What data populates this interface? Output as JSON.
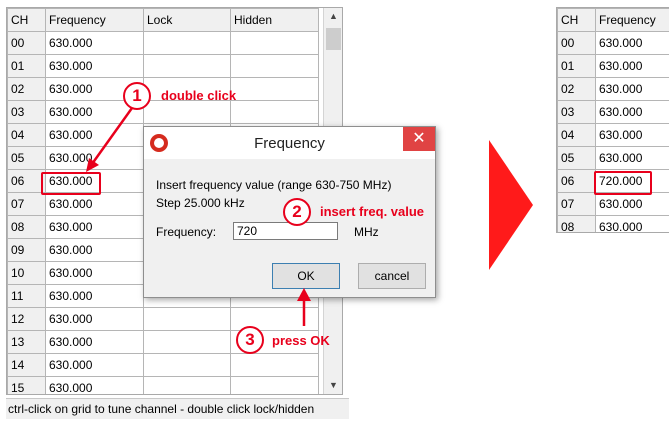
{
  "left_grid": {
    "headers": [
      "CH",
      "Frequency",
      "Lock",
      "Hidden"
    ],
    "rows": [
      {
        "ch": "00",
        "freq": "630.000"
      },
      {
        "ch": "01",
        "freq": "630.000"
      },
      {
        "ch": "02",
        "freq": "630.000"
      },
      {
        "ch": "03",
        "freq": "630.000"
      },
      {
        "ch": "04",
        "freq": "630.000"
      },
      {
        "ch": "05",
        "freq": "630.000"
      },
      {
        "ch": "06",
        "freq": "630.000"
      },
      {
        "ch": "07",
        "freq": "630.000"
      },
      {
        "ch": "08",
        "freq": "630.000"
      },
      {
        "ch": "09",
        "freq": "630.000"
      },
      {
        "ch": "10",
        "freq": "630.000"
      },
      {
        "ch": "11",
        "freq": "630.000"
      },
      {
        "ch": "12",
        "freq": "630.000"
      },
      {
        "ch": "13",
        "freq": "630.000"
      },
      {
        "ch": "14",
        "freq": "630.000"
      },
      {
        "ch": "15",
        "freq": "630.000"
      }
    ],
    "status_text": "ctrl-click on grid to tune channel - double click lock/hidden"
  },
  "dialog": {
    "title": "Frequency",
    "close_glyph": "✕",
    "line1": "Insert frequency value (range 630-750 MHz)",
    "line2": "Step 25.000 kHz",
    "field_label": "Frequency:",
    "field_value": "720",
    "unit": "MHz",
    "ok_label": "OK",
    "cancel_label": "cancel"
  },
  "annotations": {
    "step1_number": "1",
    "step1_label": "double click",
    "step2_number": "2",
    "step2_label": "insert freq. value",
    "step3_number": "3",
    "step3_label": "press OK",
    "accent_color": "#e8001c"
  },
  "right_grid": {
    "headers": [
      "CH",
      "Frequency"
    ],
    "rows": [
      {
        "ch": "00",
        "freq": "630.000"
      },
      {
        "ch": "01",
        "freq": "630.000"
      },
      {
        "ch": "02",
        "freq": "630.000"
      },
      {
        "ch": "03",
        "freq": "630.000"
      },
      {
        "ch": "04",
        "freq": "630.000"
      },
      {
        "ch": "05",
        "freq": "630.000"
      },
      {
        "ch": "06",
        "freq": "720.000"
      },
      {
        "ch": "07",
        "freq": "630.000"
      },
      {
        "ch": "08",
        "freq": "630.000"
      }
    ]
  }
}
